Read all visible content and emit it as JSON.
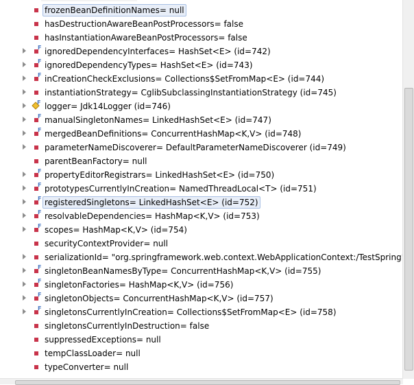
{
  "variables": [
    {
      "label": "frozenBeanDefinitionNames= null",
      "icon": "private-field-icon",
      "expandable": false,
      "selected": true
    },
    {
      "label": "hasDestructionAwareBeanPostProcessors= false",
      "icon": "private-field-icon",
      "expandable": false
    },
    {
      "label": "hasInstantiationAwareBeanPostProcessors= false",
      "icon": "private-field-icon",
      "expandable": false
    },
    {
      "label": "ignoredDependencyInterfaces= HashSet<E>  (id=742)",
      "icon": "private-final-field-icon",
      "expandable": true
    },
    {
      "label": "ignoredDependencyTypes= HashSet<E>  (id=743)",
      "icon": "private-final-field-icon",
      "expandable": true
    },
    {
      "label": "inCreationCheckExclusions= Collections$SetFromMap<E>  (id=744)",
      "icon": "private-final-field-icon",
      "expandable": true
    },
    {
      "label": "instantiationStrategy= CglibSubclassingInstantiationStrategy  (id=745)",
      "icon": "private-field-icon",
      "expandable": true
    },
    {
      "label": "logger= Jdk14Logger  (id=746)",
      "icon": "protected-final-field-icon",
      "expandable": true
    },
    {
      "label": "manualSingletonNames= LinkedHashSet<E>  (id=747)",
      "icon": "private-final-field-icon",
      "expandable": true
    },
    {
      "label": "mergedBeanDefinitions= ConcurrentHashMap<K,V>  (id=748)",
      "icon": "private-final-field-icon",
      "expandable": true
    },
    {
      "label": "parameterNameDiscoverer= DefaultParameterNameDiscoverer  (id=749)",
      "icon": "private-field-icon",
      "expandable": true
    },
    {
      "label": "parentBeanFactory= null",
      "icon": "private-field-icon",
      "expandable": false
    },
    {
      "label": "propertyEditorRegistrars= LinkedHashSet<E>  (id=750)",
      "icon": "private-final-field-icon",
      "expandable": true
    },
    {
      "label": "prototypesCurrentlyInCreation= NamedThreadLocal<T>  (id=751)",
      "icon": "private-final-field-icon",
      "expandable": true
    },
    {
      "label": "registeredSingletons= LinkedHashSet<E>  (id=752)",
      "icon": "private-final-field-icon",
      "expandable": true,
      "selected": true
    },
    {
      "label": "resolvableDependencies= HashMap<K,V>  (id=753)",
      "icon": "private-final-field-icon",
      "expandable": true
    },
    {
      "label": "scopes= HashMap<K,V>  (id=754)",
      "icon": "private-final-field-icon",
      "expandable": true
    },
    {
      "label": "securityContextProvider= null",
      "icon": "private-field-icon",
      "expandable": false
    },
    {
      "label": "serializationId= \"org.springframework.web.context.WebApplicationContext:/TestSpring\" (i",
      "icon": "private-field-icon",
      "expandable": true
    },
    {
      "label": "singletonBeanNamesByType= ConcurrentHashMap<K,V>  (id=755)",
      "icon": "private-final-field-icon",
      "expandable": true
    },
    {
      "label": "singletonFactories= HashMap<K,V>  (id=756)",
      "icon": "private-final-field-icon",
      "expandable": true
    },
    {
      "label": "singletonObjects= ConcurrentHashMap<K,V>  (id=757)",
      "icon": "private-final-field-icon",
      "expandable": true
    },
    {
      "label": "singletonsCurrentlyInCreation= Collections$SetFromMap<E>  (id=758)",
      "icon": "private-final-field-icon",
      "expandable": true
    },
    {
      "label": "singletonsCurrentlyInDestruction= false",
      "icon": "private-field-icon",
      "expandable": false
    },
    {
      "label": "suppressedExceptions= null",
      "icon": "private-field-icon",
      "expandable": false
    },
    {
      "label": "tempClassLoader= null",
      "icon": "private-field-icon",
      "expandable": false
    },
    {
      "label": "typeConverter= null",
      "icon": "private-field-icon",
      "expandable": false
    }
  ],
  "colors": {
    "private_field": "#c8334a",
    "final_marker": "#4a78c2",
    "protected_field": "#f0c030",
    "selection_bg": "#e8eef8",
    "selection_border": "#a7bfe3"
  }
}
